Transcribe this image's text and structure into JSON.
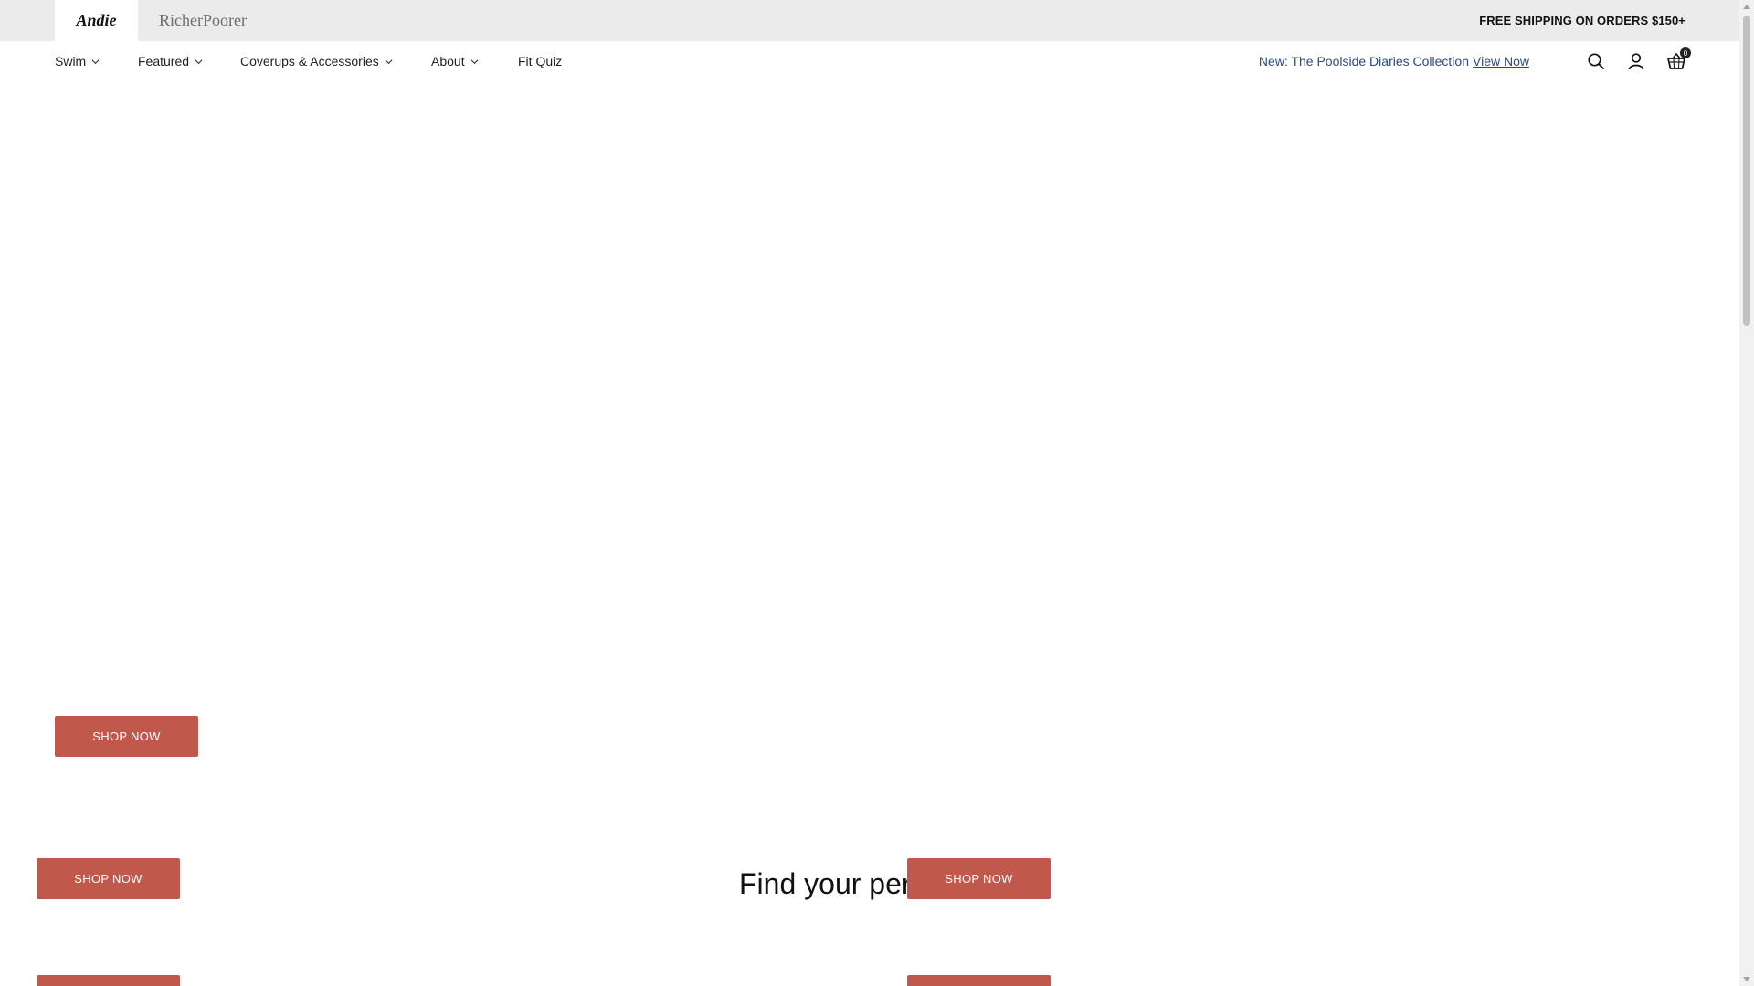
{
  "topbar": {
    "brands": [
      {
        "label": "Andie",
        "active": true
      },
      {
        "label": "RicherPoorer",
        "active": false
      }
    ],
    "shipping_text": "FREE SHIPPING ON ORDERS $150+"
  },
  "nav": {
    "items": [
      {
        "label": "Swim",
        "has_dropdown": true
      },
      {
        "label": "Featured",
        "has_dropdown": true
      },
      {
        "label": "Coverups & Accessories",
        "has_dropdown": true
      },
      {
        "label": "About",
        "has_dropdown": true
      },
      {
        "label": "Fit Quiz",
        "has_dropdown": false
      }
    ],
    "promo_text": "New: The Poolside Diaries Collection",
    "promo_link": "View Now",
    "icons": [
      "search-icon",
      "account-icon",
      "cart-icon"
    ],
    "cart_count": "0"
  },
  "hero": {
    "cta_label": "SHOP NOW"
  },
  "section": {
    "heading": "Find your per",
    "cta_label": "SHOP NOW"
  },
  "colors": {
    "topbar_bg": "#ebebeb",
    "cta_bg": "#c1584c",
    "promo_text": "#2c4a7d"
  }
}
